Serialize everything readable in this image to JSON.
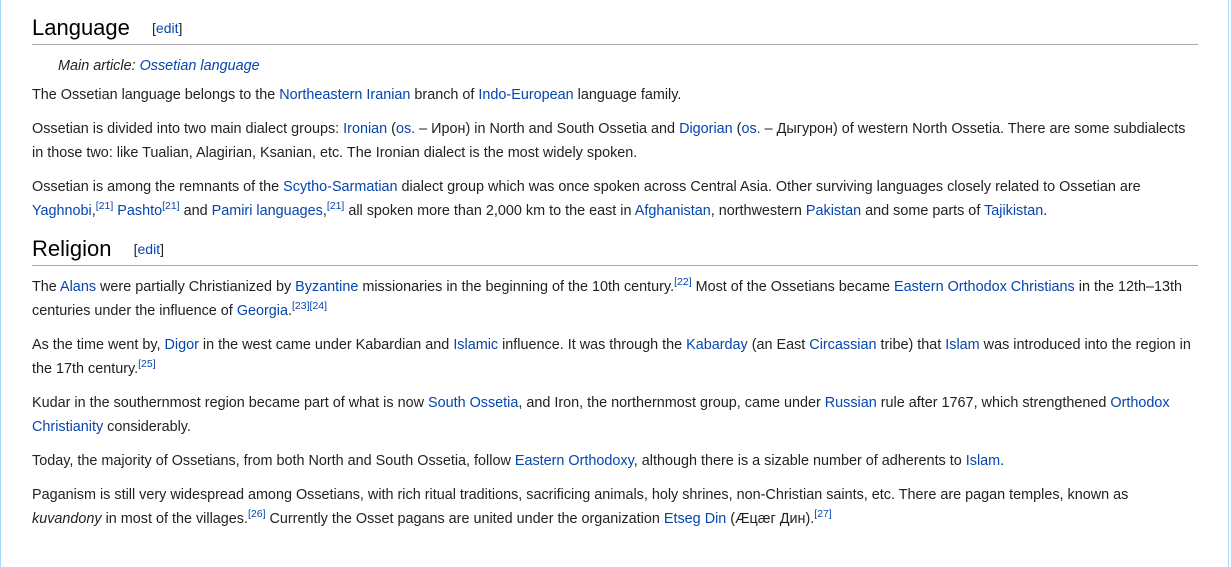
{
  "language": {
    "heading": "Language",
    "edit": "edit",
    "hatnote_label": "Main article: ",
    "hatnote_link": "Ossetian language",
    "p1": [
      {
        "t": "The Ossetian language belongs to the "
      },
      {
        "l": "Northeastern Iranian"
      },
      {
        "t": " branch of "
      },
      {
        "l": "Indo-European"
      },
      {
        "t": " language family."
      }
    ],
    "p2": [
      {
        "t": "Ossetian is divided into two main dialect groups: "
      },
      {
        "l": "Ironian"
      },
      {
        "t": " ("
      },
      {
        "l": "os."
      },
      {
        "t": " – Ирон) in North and South Ossetia and "
      },
      {
        "l": "Digorian"
      },
      {
        "t": " ("
      },
      {
        "l": "os."
      },
      {
        "t": " – Дыгурон) of western North Ossetia. There are some subdialects in those two: like Tualian, Alagirian, Ksanian, etc. The Ironian dialect is the most widely spoken."
      }
    ],
    "p3": [
      {
        "t": "Ossetian is among the remnants of the "
      },
      {
        "l": "Scytho-Sarmatian"
      },
      {
        "t": " dialect group which was once spoken across Central Asia. Other surviving languages closely related to Ossetian are "
      },
      {
        "l": "Yaghnobi"
      },
      {
        "t": ","
      },
      {
        "s": "[21]"
      },
      {
        "t": " "
      },
      {
        "l": "Pashto"
      },
      {
        "s": "[21]"
      },
      {
        "t": " and "
      },
      {
        "l": "Pamiri languages"
      },
      {
        "t": ","
      },
      {
        "s": "[21]"
      },
      {
        "t": " all spoken more than 2,000 km to the east in "
      },
      {
        "l": "Afghanistan"
      },
      {
        "t": ", northwestern "
      },
      {
        "l": "Pakistan"
      },
      {
        "t": " and some parts of "
      },
      {
        "l": "Tajikistan"
      },
      {
        "t": "."
      }
    ]
  },
  "religion": {
    "heading": "Religion",
    "edit": "edit",
    "p1": [
      {
        "t": "The "
      },
      {
        "l": "Alans"
      },
      {
        "t": " were partially Christianized by "
      },
      {
        "l": "Byzantine"
      },
      {
        "t": " missionaries in the beginning of the 10th century."
      },
      {
        "s": "[22]"
      },
      {
        "t": " Most of the Ossetians became "
      },
      {
        "l": "Eastern Orthodox Christians"
      },
      {
        "t": " in the 12th–13th centuries under the influence of "
      },
      {
        "l": "Georgia"
      },
      {
        "t": "."
      },
      {
        "s": "[23]"
      },
      {
        "s": "[24]"
      }
    ],
    "p2": [
      {
        "t": "As the time went by, "
      },
      {
        "l": "Digor"
      },
      {
        "t": " in the west came under Kabardian and "
      },
      {
        "l": "Islamic"
      },
      {
        "t": " influence. It was through the "
      },
      {
        "l": "Kabarday"
      },
      {
        "t": " (an East "
      },
      {
        "l": "Circassian"
      },
      {
        "t": " tribe) that "
      },
      {
        "l": "Islam"
      },
      {
        "t": " was introduced into the region in the 17th century."
      },
      {
        "s": "[25]"
      }
    ],
    "p3": [
      {
        "t": "Kudar in the southernmost region became part of what is now "
      },
      {
        "l": "South Ossetia"
      },
      {
        "t": ", and Iron, the northernmost group, came under "
      },
      {
        "l": "Russian"
      },
      {
        "t": " rule after 1767, which strengthened "
      },
      {
        "l": "Orthodox Christianity"
      },
      {
        "t": " considerably."
      }
    ],
    "p4": [
      {
        "t": "Today, the majority of Ossetians, from both North and South Ossetia, follow "
      },
      {
        "l": "Eastern Orthodoxy"
      },
      {
        "t": ", although there is a sizable number of adherents to "
      },
      {
        "l": "Islam"
      },
      {
        "t": "."
      }
    ],
    "p5": [
      {
        "t": "Paganism is still very widespread among Ossetians, with rich ritual traditions, sacrificing animals, holy shrines, non-Christian saints, etc. There are pagan temples, known as "
      },
      {
        "i": "kuvandony"
      },
      {
        "t": " in most of the villages."
      },
      {
        "s": "[26]"
      },
      {
        "t": " Currently the Osset pagans are united under the organization "
      },
      {
        "l": "Etseg Din"
      },
      {
        "t": " (Æцæг Дин)."
      },
      {
        "s": "[27]"
      }
    ]
  }
}
